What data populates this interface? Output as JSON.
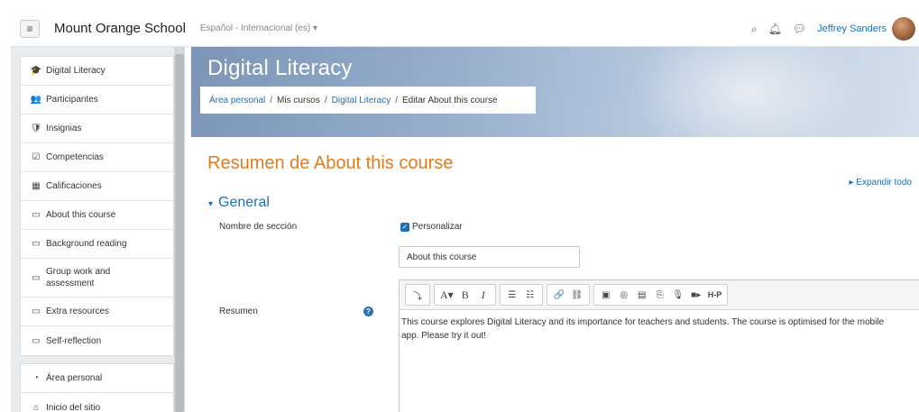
{
  "navbar": {
    "menu_icon": "hamburger-icon",
    "site_name": "Mount Orange School",
    "language": "Español - Internacional (es) ▾",
    "icons": [
      "search-icon",
      "bell-icon",
      "chat-icon"
    ],
    "user_name": "Jeffrey Sanders"
  },
  "sidebar": {
    "course_items": [
      {
        "label": "Digital Literacy",
        "icon": "graduation-cap-icon",
        "glyph": "🎓"
      },
      {
        "label": "Participantes",
        "icon": "users-icon",
        "glyph": "👥"
      },
      {
        "label": "Insignias",
        "icon": "shield-icon",
        "glyph": "🛡"
      },
      {
        "label": "Competencias",
        "icon": "checkbox-icon",
        "glyph": "☑"
      },
      {
        "label": "Calificaciones",
        "icon": "table-icon",
        "glyph": "▦"
      },
      {
        "label": "About this course",
        "icon": "folder-icon",
        "glyph": "▭"
      },
      {
        "label": "Background reading",
        "icon": "folder-icon",
        "glyph": "▭"
      },
      {
        "label": "Group work and assessment",
        "icon": "folder-icon",
        "glyph": "▭"
      },
      {
        "label": "Extra resources",
        "icon": "folder-icon",
        "glyph": "▭"
      },
      {
        "label": "Self-reflection",
        "icon": "folder-icon",
        "glyph": "▭"
      }
    ],
    "site_items": [
      {
        "label": "Área personal",
        "icon": "tachometer-icon",
        "glyph": "◔"
      },
      {
        "label": "Inicio del sitio",
        "icon": "home-icon",
        "glyph": "⌂"
      }
    ]
  },
  "header": {
    "course_title": "Digital Literacy",
    "breadcrumb": {
      "home": "Área personal",
      "courses": "Mis cursos",
      "course": "Digital Literacy",
      "current": "Editar About this course",
      "separator": "/"
    }
  },
  "main": {
    "summary_title": "Resumen de About this course",
    "expand_all": "▸ Expandir todo",
    "section_heading": "General",
    "section_caret": "▾",
    "section_name_label": "Nombre de sección",
    "customize_label": "Personalizar",
    "customize_checked": true,
    "section_name_value": "About this course",
    "summary_label": "Resumen",
    "help_glyph": "?",
    "editor_text": "This course explores Digital Literacy and its importance for teachers and students. The course is optimised for the mobile app. Please try it out!",
    "toolbar": [
      {
        "name": "toolbar-toggle-button",
        "glyph": "⤵",
        "group": 0
      },
      {
        "name": "paragraph-styles-button",
        "glyph": "A▾",
        "group": 1
      },
      {
        "name": "bold-button",
        "glyph": "B",
        "group": 1
      },
      {
        "name": "italic-button",
        "glyph": "I",
        "group": 1
      },
      {
        "name": "unordered-list-button",
        "glyph": "☰",
        "group": 2
      },
      {
        "name": "ordered-list-button",
        "glyph": "☷",
        "group": 2
      },
      {
        "name": "link-button",
        "glyph": "🔗",
        "group": 3
      },
      {
        "name": "unlink-button",
        "glyph": "⛓",
        "group": 3
      },
      {
        "name": "image-button",
        "glyph": "▣",
        "group": 4
      },
      {
        "name": "media-button",
        "glyph": "◎",
        "group": 4
      },
      {
        "name": "file-button",
        "glyph": "▤",
        "group": 4
      },
      {
        "name": "manage-files-button",
        "glyph": "⎘",
        "group": 4
      },
      {
        "name": "record-audio-button",
        "glyph": "🎙",
        "group": 4
      },
      {
        "name": "record-video-button",
        "glyph": "■▸",
        "group": 4
      },
      {
        "name": "h5p-button",
        "glyph": "H-P",
        "group": 4
      }
    ]
  },
  "colors": {
    "link": "#1f6fb5",
    "accent_orange": "#e27b1d",
    "sidebar_bg": "#e9ecef"
  }
}
